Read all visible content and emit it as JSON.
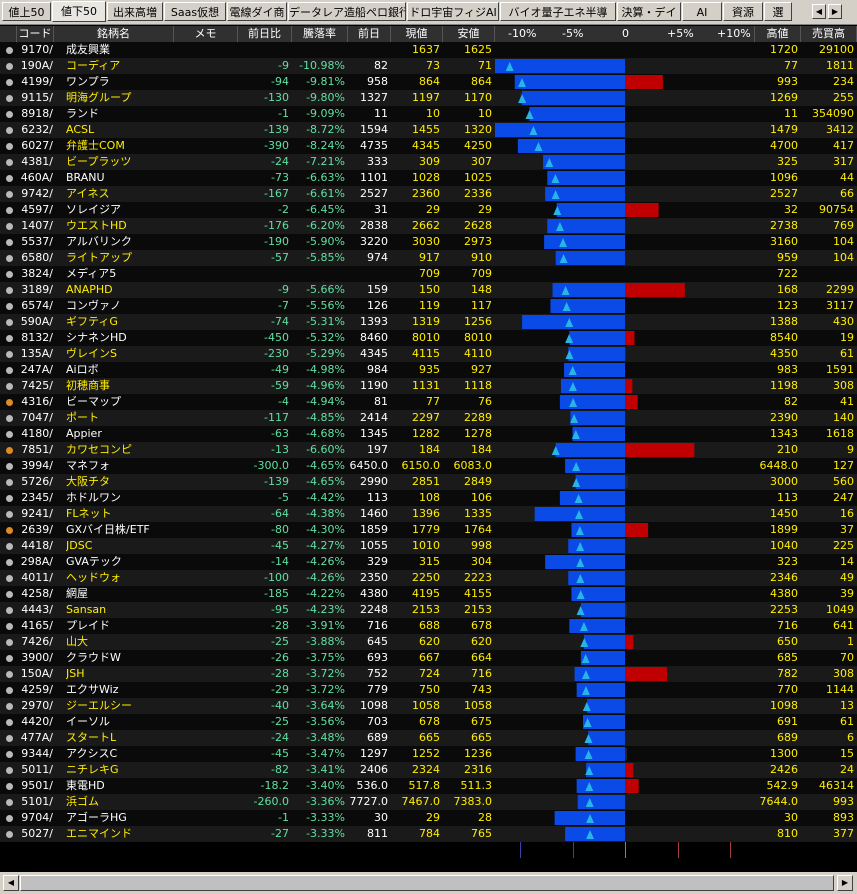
{
  "tabs": [
    "値上50",
    "値下50",
    "出来高増",
    "Saas仮想",
    "電線ダイ商",
    "データレア造船ペロ銀行",
    "ドロ宇宙フィジAI",
    "バイオ量子エネ半導",
    "決算・デイ",
    "AI",
    "資源",
    "選"
  ],
  "active_tab": 1,
  "headers": {
    "code": "コード",
    "name": "銘柄名",
    "memo": "メモ",
    "chg": "前日比",
    "pct": "騰落率",
    "prev": "前日",
    "cur": "現値",
    "low": "安値",
    "m10": "-10%",
    "m5": "-5%",
    "z": "0",
    "p5": "+5%",
    "p10": "+10%",
    "hi": "高値",
    "vol": "売買高"
  },
  "colors": {
    "bar_blue": "#0a4be8",
    "bar_red": "#c00000",
    "bar_dark": "#262626",
    "triangle": "#28b4e8"
  },
  "rows": [
    {
      "code": "9170/",
      "name": "成友興業",
      "y": false,
      "dot": "g",
      "chg": "",
      "pct": "",
      "prev": "",
      "cur": "1637",
      "low": "1625",
      "hi": "1720",
      "vol": "29100",
      "range": [
        -10,
        -10
      ],
      "bar": 0,
      "tri": null
    },
    {
      "code": "190A/",
      "name": "コーディア",
      "y": true,
      "dot": "g",
      "chg": "-9",
      "pct": "-10.98%",
      "prev": "82",
      "cur": "73",
      "low": "71",
      "hi": "77",
      "vol": "1811",
      "range": [
        -11.5,
        -5.5
      ],
      "bar": -13.3,
      "tri": -10.98
    },
    {
      "code": "4199/",
      "name": "ワンプラ",
      "y": false,
      "dot": "g",
      "chg": "-94",
      "pct": "-9.81%",
      "prev": "958",
      "cur": "864",
      "low": "864",
      "hi": "993",
      "vol": "234",
      "range": [
        -9.8,
        3.6
      ],
      "bar": -10.5,
      "tri": -9.81
    },
    {
      "code": "9115/",
      "name": "明海グループ",
      "y": true,
      "dot": "g",
      "chg": "-130",
      "pct": "-9.80%",
      "prev": "1327",
      "cur": "1197",
      "low": "1170",
      "hi": "1269",
      "vol": "255",
      "range": [
        -10,
        -4.4
      ],
      "bar": -9.8,
      "tri": -9.8
    },
    {
      "code": "8918/",
      "name": "ランド",
      "y": false,
      "dot": "g",
      "chg": "-1",
      "pct": "-9.09%",
      "prev": "11",
      "cur": "10",
      "low": "10",
      "hi": "11",
      "vol": "354090",
      "range": [
        -9.1,
        0
      ],
      "bar": -9.1,
      "tri": -9.09
    },
    {
      "code": "6232/",
      "name": "ACSL",
      "y": true,
      "dot": "g",
      "chg": "-139",
      "pct": "-8.72%",
      "prev": "1594",
      "cur": "1455",
      "low": "1320",
      "hi": "1479",
      "vol": "3412",
      "range": [
        -17,
        -7
      ],
      "bar": -17,
      "tri": -8.72
    },
    {
      "code": "6027/",
      "name": "弁護士COM",
      "y": true,
      "dot": "g",
      "chg": "-390",
      "pct": "-8.24%",
      "prev": "4735",
      "cur": "4345",
      "low": "4250",
      "hi": "4700",
      "vol": "417",
      "range": [
        -10.2,
        -0.7
      ],
      "bar": -10.2,
      "tri": -8.24
    },
    {
      "code": "4381/",
      "name": "ビープラッツ",
      "y": true,
      "dot": "g",
      "chg": "-24",
      "pct": "-7.21%",
      "prev": "333",
      "cur": "309",
      "low": "307",
      "hi": "325",
      "vol": "317",
      "range": [
        -7.8,
        -2.4
      ],
      "bar": -7.8,
      "tri": -7.21
    },
    {
      "code": "460A/",
      "name": "BRANU",
      "y": false,
      "dot": "g",
      "chg": "-73",
      "pct": "-6.63%",
      "prev": "1101",
      "cur": "1028",
      "low": "1025",
      "hi": "1096",
      "vol": "44",
      "range": [
        -6.9,
        -0.5
      ],
      "bar": -7.4,
      "tri": -6.63
    },
    {
      "code": "9742/",
      "name": "アイネス",
      "y": true,
      "dot": "g",
      "chg": "-167",
      "pct": "-6.61%",
      "prev": "2527",
      "cur": "2360",
      "low": "2336",
      "hi": "2527",
      "vol": "66",
      "range": [
        -7.6,
        0
      ],
      "bar": -7.6,
      "tri": -6.61
    },
    {
      "code": "4597/",
      "name": "ソレイジア",
      "y": false,
      "dot": "g",
      "chg": "-2",
      "pct": "-6.45%",
      "prev": "31",
      "cur": "29",
      "low": "29",
      "hi": "32",
      "vol": "90754",
      "range": [
        -6.5,
        3.2
      ],
      "bar": -6.5,
      "tri": -6.45
    },
    {
      "code": "1407/",
      "name": "ウエストHD",
      "y": true,
      "dot": "g",
      "chg": "-176",
      "pct": "-6.20%",
      "prev": "2838",
      "cur": "2662",
      "low": "2628",
      "hi": "2738",
      "vol": "769",
      "range": [
        -7.4,
        -3.5
      ],
      "bar": -7.4,
      "tri": -6.2
    },
    {
      "code": "5537/",
      "name": "アルバリンク",
      "y": false,
      "dot": "g",
      "chg": "-190",
      "pct": "-5.90%",
      "prev": "3220",
      "cur": "3030",
      "low": "2973",
      "hi": "3160",
      "vol": "104",
      "range": [
        -7.7,
        -1.9
      ],
      "bar": -7.7,
      "tri": -5.9
    },
    {
      "code": "6580/",
      "name": "ライトアップ",
      "y": true,
      "dot": "g",
      "chg": "-57",
      "pct": "-5.85%",
      "prev": "974",
      "cur": "917",
      "low": "910",
      "hi": "959",
      "vol": "104",
      "range": [
        -6.6,
        -1.5
      ],
      "bar": -6.6,
      "tri": -5.85
    },
    {
      "code": "3824/",
      "name": "メディア5",
      "y": false,
      "dot": "g",
      "chg": "",
      "pct": "",
      "prev": "",
      "cur": "709",
      "low": "709",
      "hi": "722",
      "vol": "",
      "range": [
        0,
        0
      ],
      "bar": 0,
      "tri": null
    },
    {
      "code": "3189/",
      "name": "ANAPHD",
      "y": true,
      "dot": "g",
      "chg": "-9",
      "pct": "-5.66%",
      "prev": "159",
      "cur": "150",
      "low": "148",
      "hi": "168",
      "vol": "2299",
      "range": [
        -6.9,
        5.7
      ],
      "bar": -6.9,
      "tri": -5.66
    },
    {
      "code": "6574/",
      "name": "コンヴァノ",
      "y": false,
      "dot": "g",
      "chg": "-7",
      "pct": "-5.56%",
      "prev": "126",
      "cur": "119",
      "low": "117",
      "hi": "123",
      "vol": "3117",
      "range": [
        -7.1,
        -2.4
      ],
      "bar": -7.1,
      "tri": -5.56
    },
    {
      "code": "590A/",
      "name": "ギフティG",
      "y": true,
      "dot": "g",
      "chg": "-74",
      "pct": "-5.31%",
      "prev": "1393",
      "cur": "1319",
      "low": "1256",
      "hi": "1388",
      "vol": "430",
      "range": [
        -9.8,
        -0.4
      ],
      "bar": -9.8,
      "tri": -5.31
    },
    {
      "code": "8132/",
      "name": "シナネンHD",
      "y": false,
      "dot": "g",
      "chg": "-450",
      "pct": "-5.32%",
      "prev": "8460",
      "cur": "8010",
      "low": "8010",
      "hi": "8540",
      "vol": "19",
      "range": [
        -5.3,
        0.9
      ],
      "bar": -5.3,
      "tri": -5.32
    },
    {
      "code": "135A/",
      "name": "ヴレインS",
      "y": true,
      "dot": "g",
      "chg": "-230",
      "pct": "-5.29%",
      "prev": "4345",
      "cur": "4115",
      "low": "4110",
      "hi": "4350",
      "vol": "61",
      "range": [
        -5.4,
        0.1
      ],
      "bar": -5.4,
      "tri": -5.29
    },
    {
      "code": "247A/",
      "name": "Aiロボ",
      "y": false,
      "dot": "g",
      "chg": "-49",
      "pct": "-4.98%",
      "prev": "984",
      "cur": "935",
      "low": "927",
      "hi": "983",
      "vol": "1591",
      "range": [
        -5.8,
        -0.1
      ],
      "bar": -5.8,
      "tri": -4.98
    },
    {
      "code": "7425/",
      "name": "初穂商事",
      "y": true,
      "dot": "g",
      "chg": "-59",
      "pct": "-4.96%",
      "prev": "1190",
      "cur": "1131",
      "low": "1118",
      "hi": "1198",
      "vol": "308",
      "range": [
        -6.1,
        0.7
      ],
      "bar": -6.1,
      "tri": -4.96
    },
    {
      "code": "4316/",
      "name": "ビーマップ",
      "y": false,
      "dot": "o",
      "chg": "-4",
      "pct": "-4.94%",
      "prev": "81",
      "cur": "77",
      "low": "76",
      "hi": "82",
      "vol": "41",
      "range": [
        -6.2,
        1.2
      ],
      "bar": -6.2,
      "tri": -4.94
    },
    {
      "code": "7047/",
      "name": "ポート",
      "y": true,
      "dot": "g",
      "chg": "-117",
      "pct": "-4.85%",
      "prev": "2414",
      "cur": "2297",
      "low": "2289",
      "hi": "2390",
      "vol": "140",
      "range": [
        -5.2,
        -1
      ],
      "bar": -5.2,
      "tri": -4.85
    },
    {
      "code": "4180/",
      "name": "Appier",
      "y": false,
      "dot": "g",
      "chg": "-63",
      "pct": "-4.68%",
      "prev": "1345",
      "cur": "1282",
      "low": "1278",
      "hi": "1343",
      "vol": "1618",
      "range": [
        -5,
        -0.1
      ],
      "bar": -5,
      "tri": -4.68
    },
    {
      "code": "7851/",
      "name": "カワセコンピ",
      "y": true,
      "dot": "o",
      "chg": "-13",
      "pct": "-6.60%",
      "prev": "197",
      "cur": "184",
      "low": "184",
      "hi": "210",
      "vol": "9",
      "range": [
        -6.6,
        6.6
      ],
      "bar": -6.6,
      "tri": -6.6
    },
    {
      "code": "3994/",
      "name": "マネフォ",
      "y": false,
      "dot": "g",
      "chg": "-300.0",
      "pct": "-4.65%",
      "prev": "6450.0",
      "cur": "6150.0",
      "low": "6083.0",
      "hi": "6448.0",
      "vol": "127",
      "range": [
        -5.7,
        0
      ],
      "bar": -5.7,
      "tri": -4.65
    },
    {
      "code": "5726/",
      "name": "大阪チタ",
      "y": true,
      "dot": "g",
      "chg": "-139",
      "pct": "-4.65%",
      "prev": "2990",
      "cur": "2851",
      "low": "2849",
      "hi": "3000",
      "vol": "560",
      "range": [
        -4.7,
        0.3
      ],
      "bar": -4.7,
      "tri": -4.65
    },
    {
      "code": "2345/",
      "name": "ホドルワン",
      "y": false,
      "dot": "g",
      "chg": "-5",
      "pct": "-4.42%",
      "prev": "113",
      "cur": "108",
      "low": "106",
      "hi": "113",
      "vol": "247",
      "range": [
        -6.2,
        0
      ],
      "bar": -6.2,
      "tri": -4.42
    },
    {
      "code": "9241/",
      "name": "FLネット",
      "y": true,
      "dot": "g",
      "chg": "-64",
      "pct": "-4.38%",
      "prev": "1460",
      "cur": "1396",
      "low": "1335",
      "hi": "1450",
      "vol": "16",
      "range": [
        -8.6,
        -0.7
      ],
      "bar": -8.6,
      "tri": -4.38
    },
    {
      "code": "2639/",
      "name": "GXバイ日株/ETF",
      "y": false,
      "dot": "o",
      "chg": "-80",
      "pct": "-4.30%",
      "prev": "1859",
      "cur": "1779",
      "low": "1764",
      "hi": "1899",
      "vol": "37",
      "range": [
        -5.1,
        2.2
      ],
      "bar": -5.1,
      "tri": -4.3
    },
    {
      "code": "4418/",
      "name": "JDSC",
      "y": true,
      "dot": "g",
      "chg": "-45",
      "pct": "-4.27%",
      "prev": "1055",
      "cur": "1010",
      "low": "998",
      "hi": "1040",
      "vol": "225",
      "range": [
        -5.4,
        -1.4
      ],
      "bar": -5.4,
      "tri": -4.27
    },
    {
      "code": "298A/",
      "name": "GVAテック",
      "y": false,
      "dot": "g",
      "chg": "-14",
      "pct": "-4.26%",
      "prev": "329",
      "cur": "315",
      "low": "304",
      "hi": "323",
      "vol": "14",
      "range": [
        -7.6,
        -1.8
      ],
      "bar": -7.6,
      "tri": -4.26
    },
    {
      "code": "4011/",
      "name": "ヘッドウォ",
      "y": true,
      "dot": "g",
      "chg": "-100",
      "pct": "-4.26%",
      "prev": "2350",
      "cur": "2250",
      "low": "2223",
      "hi": "2346",
      "vol": "49",
      "range": [
        -5.4,
        -0.2
      ],
      "bar": -5.4,
      "tri": -4.26
    },
    {
      "code": "4258/",
      "name": "網屋",
      "y": false,
      "dot": "g",
      "chg": "-185",
      "pct": "-4.22%",
      "prev": "4380",
      "cur": "4195",
      "low": "4155",
      "hi": "4380",
      "vol": "39",
      "range": [
        -5.1,
        0
      ],
      "bar": -5.1,
      "tri": -4.22
    },
    {
      "code": "4443/",
      "name": "Sansan",
      "y": true,
      "dot": "g",
      "chg": "-95",
      "pct": "-4.23%",
      "prev": "2248",
      "cur": "2153",
      "low": "2153",
      "hi": "2253",
      "vol": "1049",
      "range": [
        -4.2,
        0.2
      ],
      "bar": -4.2,
      "tri": -4.23
    },
    {
      "code": "4165/",
      "name": "プレイド",
      "y": false,
      "dot": "g",
      "chg": "-28",
      "pct": "-3.91%",
      "prev": "716",
      "cur": "688",
      "low": "678",
      "hi": "716",
      "vol": "641",
      "range": [
        -5.3,
        0
      ],
      "bar": -5.3,
      "tri": -3.91
    },
    {
      "code": "7426/",
      "name": "山大",
      "y": true,
      "dot": "g",
      "chg": "-25",
      "pct": "-3.88%",
      "prev": "645",
      "cur": "620",
      "low": "620",
      "hi": "650",
      "vol": "1",
      "range": [
        -3.9,
        0.8
      ],
      "bar": -3.9,
      "tri": -3.88
    },
    {
      "code": "3900/",
      "name": "クラウドW",
      "y": false,
      "dot": "g",
      "chg": "-26",
      "pct": "-3.75%",
      "prev": "693",
      "cur": "667",
      "low": "664",
      "hi": "685",
      "vol": "70",
      "range": [
        -4.2,
        -1.2
      ],
      "bar": -4.2,
      "tri": -3.75
    },
    {
      "code": "150A/",
      "name": "JSH",
      "y": true,
      "dot": "g",
      "chg": "-28",
      "pct": "-3.72%",
      "prev": "752",
      "cur": "724",
      "low": "716",
      "hi": "782",
      "vol": "308",
      "range": [
        -4.8,
        4
      ],
      "bar": -4.8,
      "tri": -3.72
    },
    {
      "code": "4259/",
      "name": "エクサWiz",
      "y": false,
      "dot": "g",
      "chg": "-29",
      "pct": "-3.72%",
      "prev": "779",
      "cur": "750",
      "low": "743",
      "hi": "770",
      "vol": "1144",
      "range": [
        -4.6,
        -1.2
      ],
      "bar": -4.6,
      "tri": -3.72
    },
    {
      "code": "2970/",
      "name": "ジーエルシー",
      "y": true,
      "dot": "g",
      "chg": "-40",
      "pct": "-3.64%",
      "prev": "1098",
      "cur": "1058",
      "low": "1058",
      "hi": "1098",
      "vol": "13",
      "range": [
        -3.6,
        0
      ],
      "bar": -3.6,
      "tri": -3.64
    },
    {
      "code": "4420/",
      "name": "イーソル",
      "y": false,
      "dot": "g",
      "chg": "-25",
      "pct": "-3.56%",
      "prev": "703",
      "cur": "678",
      "low": "675",
      "hi": "691",
      "vol": "61",
      "range": [
        -4,
        -1.7
      ],
      "bar": -4,
      "tri": -3.56
    },
    {
      "code": "477A/",
      "name": "スタートL",
      "y": true,
      "dot": "g",
      "chg": "-24",
      "pct": "-3.48%",
      "prev": "689",
      "cur": "665",
      "low": "665",
      "hi": "689",
      "vol": "6",
      "range": [
        -3.5,
        0
      ],
      "bar": -3.5,
      "tri": -3.48
    },
    {
      "code": "9344/",
      "name": "アクシスC",
      "y": false,
      "dot": "g",
      "chg": "-45",
      "pct": "-3.47%",
      "prev": "1297",
      "cur": "1252",
      "low": "1236",
      "hi": "1300",
      "vol": "15",
      "range": [
        -4.7,
        0.2
      ],
      "bar": -4.7,
      "tri": -3.47
    },
    {
      "code": "5011/",
      "name": "ニチレキG",
      "y": true,
      "dot": "g",
      "chg": "-82",
      "pct": "-3.41%",
      "prev": "2406",
      "cur": "2324",
      "low": "2316",
      "hi": "2426",
      "vol": "24",
      "range": [
        -3.7,
        0.8
      ],
      "bar": -3.7,
      "tri": -3.41
    },
    {
      "code": "9501/",
      "name": "東電HD",
      "y": false,
      "dot": "g",
      "chg": "-18.2",
      "pct": "-3.40%",
      "prev": "536.0",
      "cur": "517.8",
      "low": "511.3",
      "hi": "542.9",
      "vol": "46314",
      "range": [
        -4.6,
        1.3
      ],
      "bar": -4.6,
      "tri": -3.4
    },
    {
      "code": "5101/",
      "name": "浜ゴム",
      "y": true,
      "dot": "g",
      "chg": "-260.0",
      "pct": "-3.36%",
      "prev": "7727.0",
      "cur": "7467.0",
      "low": "7383.0",
      "hi": "7644.0",
      "vol": "993",
      "range": [
        -4.5,
        -1.1
      ],
      "bar": -4.5,
      "tri": -3.36
    },
    {
      "code": "9704/",
      "name": "アゴーラHG",
      "y": false,
      "dot": "g",
      "chg": "-1",
      "pct": "-3.33%",
      "prev": "30",
      "cur": "29",
      "low": "28",
      "hi": "30",
      "vol": "893",
      "range": [
        -6.7,
        0
      ],
      "bar": -6.7,
      "tri": -3.33
    },
    {
      "code": "5027/",
      "name": "エニマインド",
      "y": true,
      "dot": "g",
      "chg": "-27",
      "pct": "-3.33%",
      "prev": "811",
      "cur": "784",
      "low": "765",
      "hi": "810",
      "vol": "377",
      "range": [
        -5.7,
        -0.1
      ],
      "bar": -5.7,
      "tri": -3.33
    }
  ]
}
